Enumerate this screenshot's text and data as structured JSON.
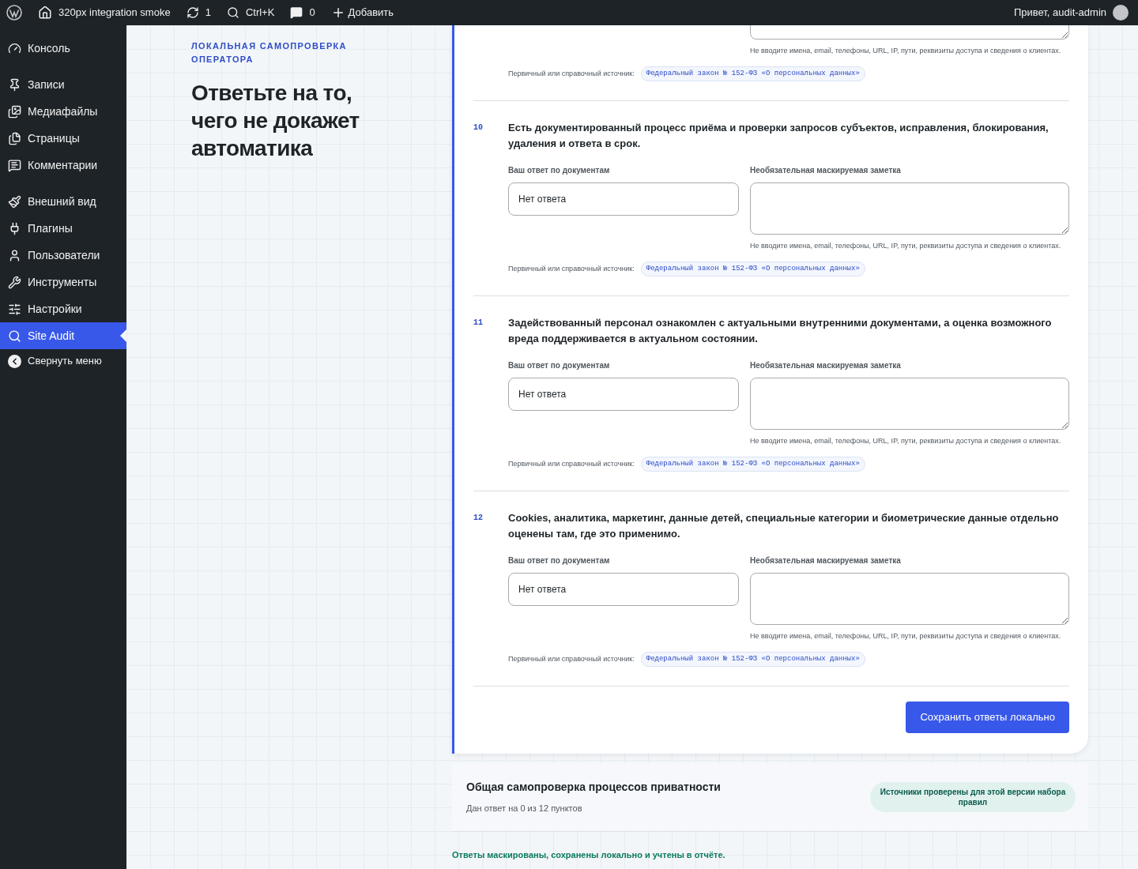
{
  "admin_bar": {
    "site": "320px integration smoke",
    "updates": "1",
    "search": "Ctrl+K",
    "comments": "0",
    "add": "Добавить",
    "greeting": "Привет, audit-admin"
  },
  "sidebar": {
    "groups": [
      [
        {
          "label": "Консоль",
          "selected": false
        }
      ],
      [
        {
          "label": "Записи",
          "selected": false
        },
        {
          "label": "Медиафайлы",
          "selected": false
        },
        {
          "label": "Страницы",
          "selected": false
        },
        {
          "label": "Комментарии",
          "selected": false
        }
      ],
      [
        {
          "label": "Внешний вид",
          "selected": false
        },
        {
          "label": "Плагины",
          "selected": false
        },
        {
          "label": "Пользователи",
          "selected": false
        },
        {
          "label": "Инструменты",
          "selected": false
        },
        {
          "label": "Настройки",
          "selected": false
        },
        {
          "label": "Site Audit",
          "selected": true
        }
      ]
    ],
    "collapse": "Свернуть меню"
  },
  "intro": {
    "eyebrow": "ЛОКАЛЬНАЯ САМОПРОВЕРКА ОПЕРАТОРА",
    "heading": "Ответьте на то, чего не докажет автоматика"
  },
  "partial_item": {
    "hint": "Не вводите имена, email, телефоны, URL, IP, пути, реквизиты доступа и сведения о клиентах.",
    "source_label": "Первичный или справочный источник:",
    "source": "Федеральный закон № 152-ФЗ «О персональных данных»"
  },
  "questions": [
    {
      "number": "10",
      "text": "Есть документированный процесс приёма и проверки запросов субъектов, исправления, блокирования, удаления и ответа в срок.",
      "answer_label": "Ваш ответ по документам",
      "answer_value": "Нет ответа",
      "note_label": "Необязательная маскируемая заметка",
      "hint": "Не вводите имена, email, телефоны, URL, IP, пути, реквизиты доступа и сведения о клиентах.",
      "source_label": "Первичный или справочный источник:",
      "source": "Федеральный закон № 152-ФЗ «О персональных данных»"
    },
    {
      "number": "11",
      "text": "Задействованный персонал ознакомлен с актуальными внутренними документами, а оценка возможного вреда поддерживается в актуальном состоянии.",
      "answer_label": "Ваш ответ по документам",
      "answer_value": "Нет ответа",
      "note_label": "Необязательная маскируемая заметка",
      "hint": "Не вводите имена, email, телефоны, URL, IP, пути, реквизиты доступа и сведения о клиентах.",
      "source_label": "Первичный или справочный источник:",
      "source": "Федеральный закон № 152-ФЗ «О персональных данных»"
    },
    {
      "number": "12",
      "text": "Cookies, аналитика, маркетинг, данные детей, специальные категории и биометрические данные отдельно оценены там, где это применимо.",
      "answer_label": "Ваш ответ по документам",
      "answer_value": "Нет ответа",
      "note_label": "Необязательная маскируемая заметка",
      "hint": "Не вводите имена, email, телефоны, URL, IP, пути, реквизиты доступа и сведения о клиентах.",
      "source_label": "Первичный или справочный источник:",
      "source": "Федеральный закон № 152-ФЗ «О персональных данных»"
    }
  ],
  "save_button": "Сохранить ответы локально",
  "summary": {
    "title": "Общая самопроверка процессов приватности",
    "subtitle": "Дан ответ на 0 из 12 пунктов",
    "badge": "Источники проверены для этой версии набора правил"
  },
  "footer_note": "Ответы маскированы, сохранены локально и учтены в отчёте."
}
